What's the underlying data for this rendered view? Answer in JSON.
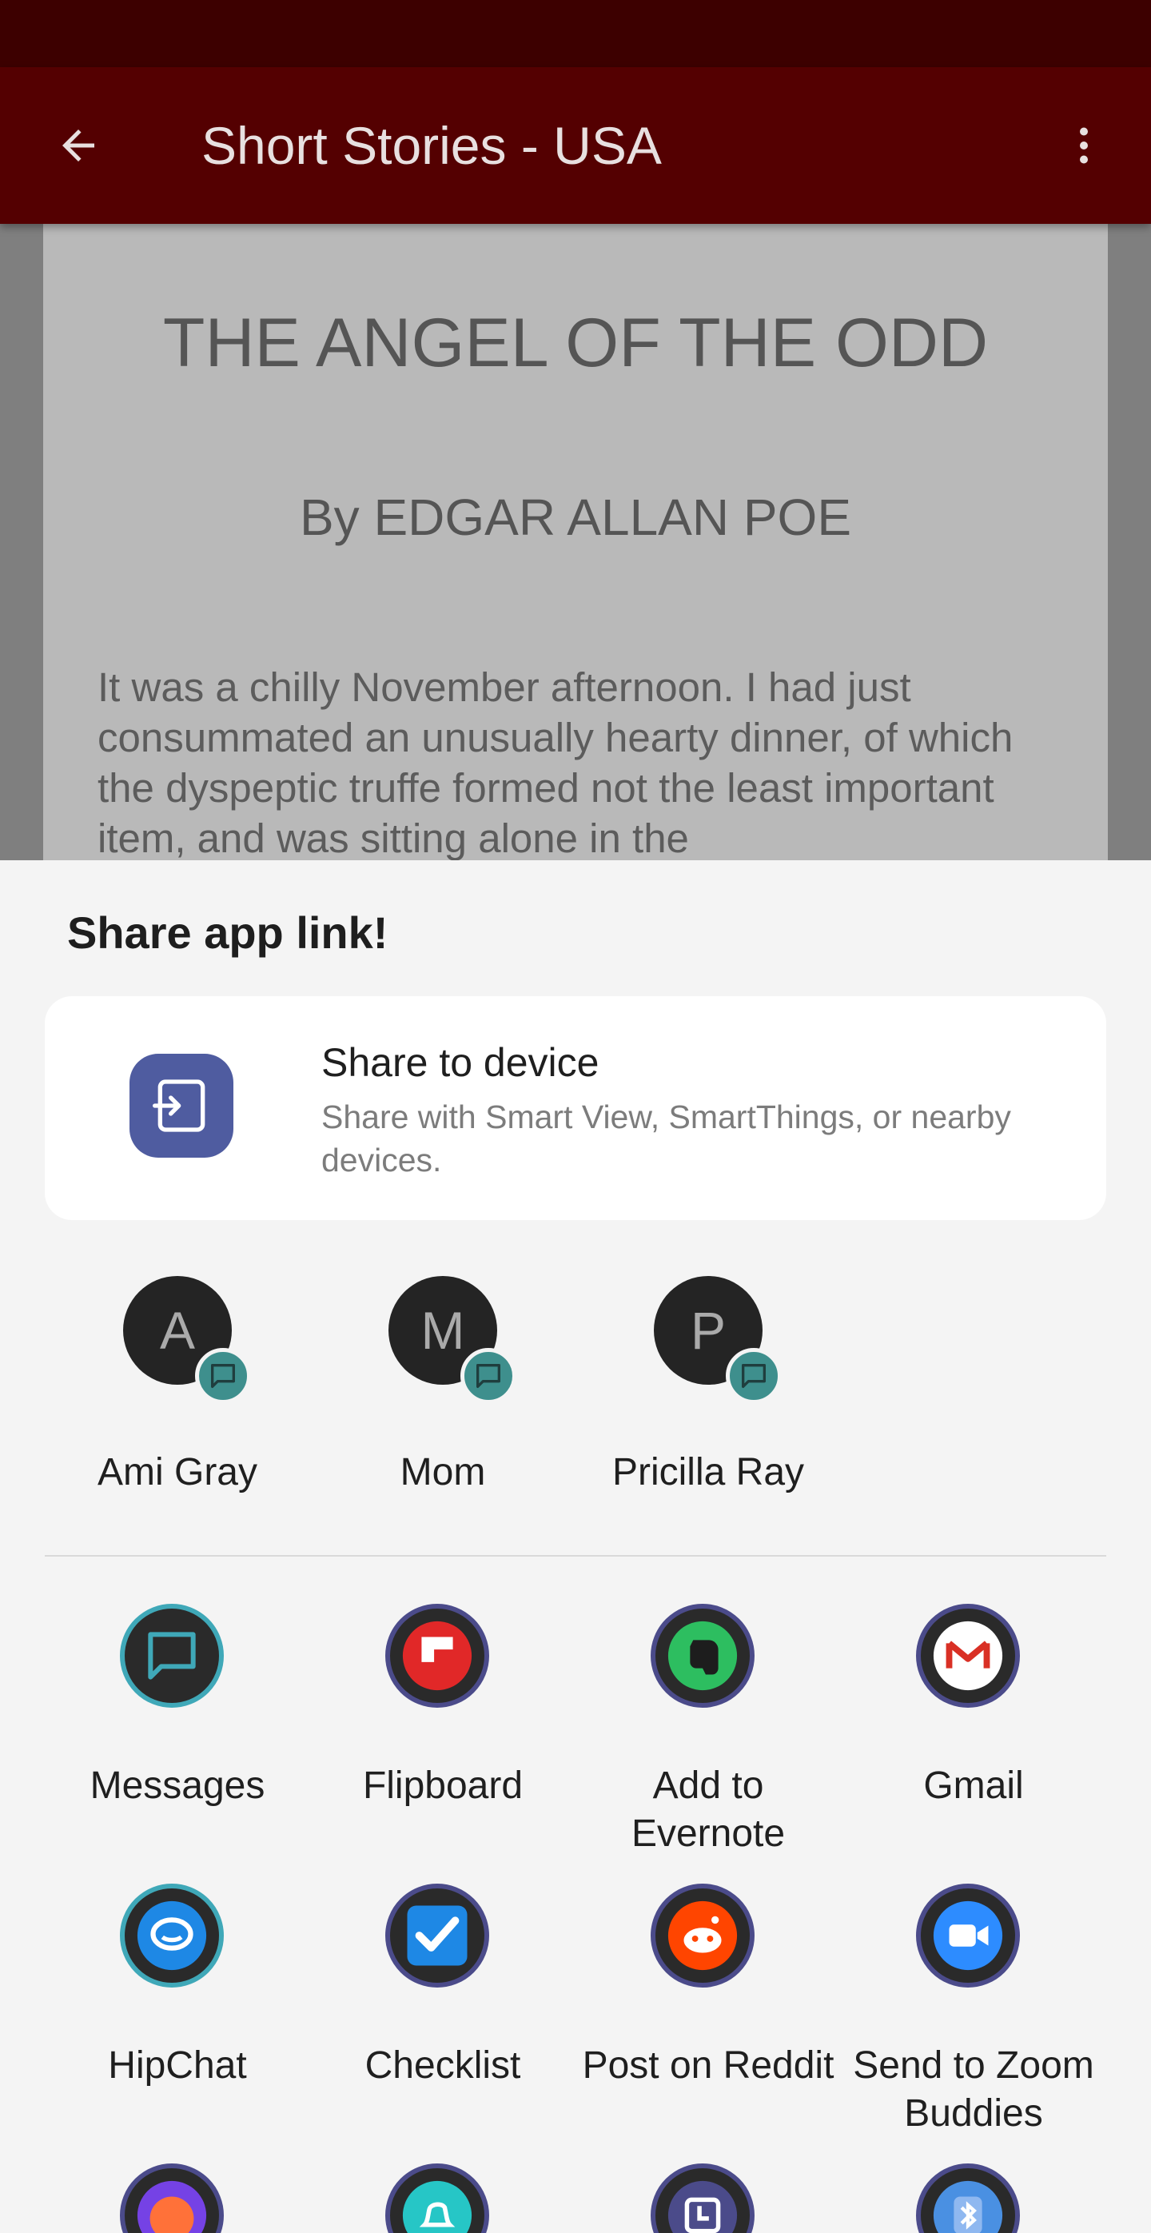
{
  "app_bar": {
    "title": "Short Stories - USA",
    "back_icon": "arrow-left-icon",
    "menu_icon": "more-vert-icon"
  },
  "article": {
    "title": "THE ANGEL OF THE ODD",
    "author": "By EDGAR ALLAN POE",
    "text": "It was a chilly November afternoon. I had just consummated an unusually hearty dinner, of which the dyspeptic truffe formed not the least important item, and was sitting alone in the"
  },
  "share_sheet": {
    "title": "Share app link!",
    "device": {
      "title": "Share to device",
      "subtitle": "Share with Smart View, SmartThings, or nearby devices."
    },
    "contacts": [
      {
        "initial": "A",
        "name": "Ami Gray"
      },
      {
        "initial": "M",
        "name": "Mom"
      },
      {
        "initial": "P",
        "name": "Pricilla Ray"
      }
    ],
    "apps": [
      {
        "label": "Messages",
        "icon": "messages-icon"
      },
      {
        "label": "Flipboard",
        "icon": "flipboard-icon"
      },
      {
        "label": "Add to Evernote",
        "icon": "evernote-icon"
      },
      {
        "label": "Gmail",
        "icon": "gmail-icon"
      },
      {
        "label": "HipChat",
        "icon": "hipchat-icon"
      },
      {
        "label": "Checklist",
        "icon": "checklist-icon"
      },
      {
        "label": "Post on Reddit",
        "icon": "reddit-icon"
      },
      {
        "label": "Send to Zoom Buddies",
        "icon": "zoom-icon"
      },
      {
        "label": "",
        "icon": "firefox-icon"
      },
      {
        "label": "",
        "icon": "notification-icon"
      },
      {
        "label": "",
        "icon": "clock-icon"
      },
      {
        "label": "",
        "icon": "bluetooth-icon"
      }
    ]
  },
  "colors": {
    "app_bar": "#540001",
    "status_bar": "#3d0000",
    "sheet_bg": "#f4f4f4",
    "device_icon": "#4f5ca0",
    "contact_badge": "#3e8f8d"
  }
}
